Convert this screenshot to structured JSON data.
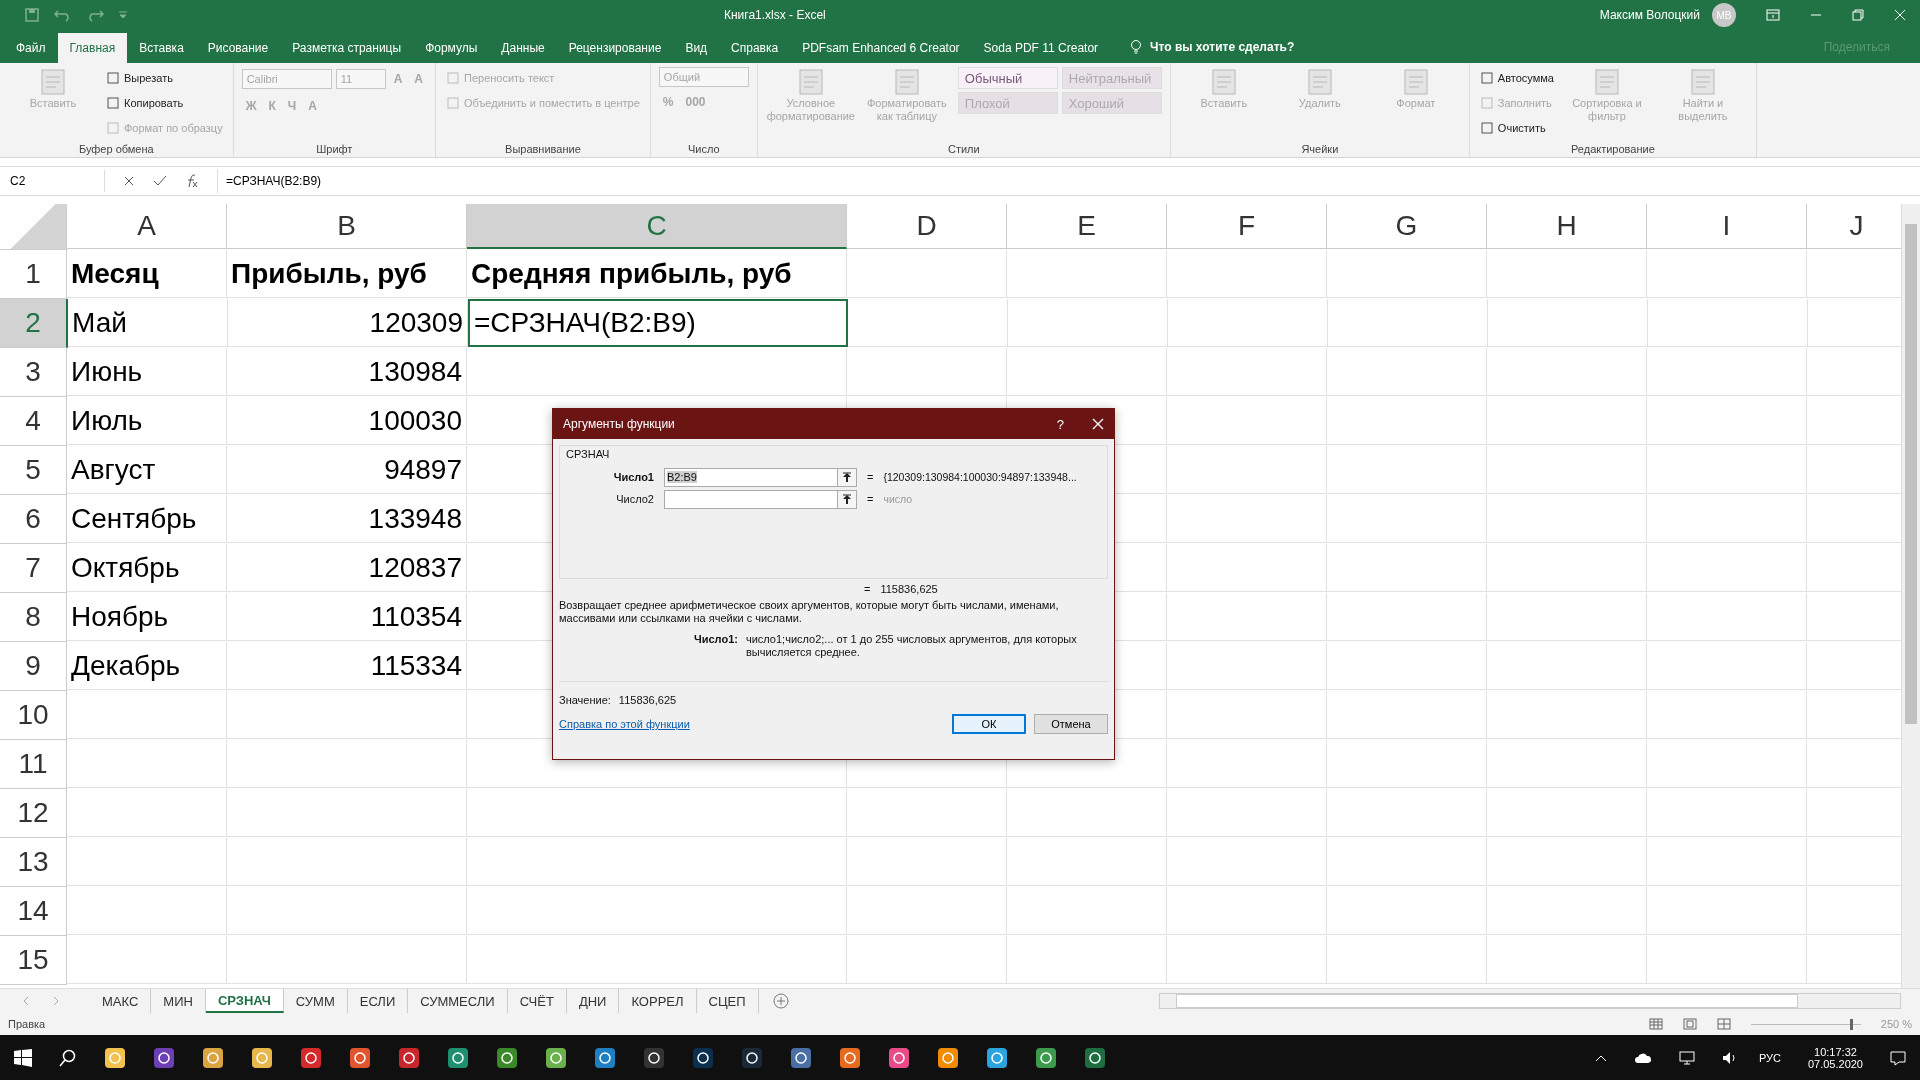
{
  "title_bar": {
    "title": "Книга1.xlsx  -  Excel",
    "user": "Максим Волоцкий",
    "avatar": "МВ"
  },
  "ribbon_tabs": [
    {
      "label": "Файл",
      "selected": false
    },
    {
      "label": "Главная",
      "selected": true
    },
    {
      "label": "Вставка",
      "selected": false
    },
    {
      "label": "Рисование",
      "selected": false
    },
    {
      "label": "Разметка страницы",
      "selected": false
    },
    {
      "label": "Формулы",
      "selected": false
    },
    {
      "label": "Данные",
      "selected": false
    },
    {
      "label": "Рецензирование",
      "selected": false
    },
    {
      "label": "Вид",
      "selected": false
    },
    {
      "label": "Справка",
      "selected": false
    },
    {
      "label": "PDFsam Enhanced 6 Creator",
      "selected": false
    },
    {
      "label": "Soda PDF 11 Creator",
      "selected": false
    }
  ],
  "tell_me": "Что вы хотите сделать?",
  "share": "Поделиться",
  "ribbon_groups": [
    {
      "label": "Буфер обмена",
      "columns": [
        [
          [
            {
              "kind": "large",
              "label": "Вставить",
              "disabled": true
            }
          ]
        ],
        [
          [
            {
              "kind": "small",
              "label": "Вырезать",
              "disabled": false
            }
          ],
          [
            {
              "kind": "small",
              "label": "Копировать",
              "disabled": false
            }
          ],
          [
            {
              "kind": "small",
              "label": "Формат по образцу",
              "disabled": true
            }
          ]
        ]
      ]
    },
    {
      "label": "Шрифт",
      "columns": [
        [
          [
            {
              "kind": "field",
              "label": "Calibri",
              "disabled": true
            },
            {
              "kind": "field",
              "label": "11",
              "disabled": true
            },
            {
              "kind": "glyph",
              "label": "A",
              "disabled": true
            },
            {
              "kind": "glyph",
              "label": "A",
              "disabled": true
            }
          ],
          [
            {
              "kind": "glyph",
              "label": "Ж",
              "disabled": true
            },
            {
              "kind": "glyph",
              "label": "К",
              "disabled": true
            },
            {
              "kind": "glyph",
              "label": "Ч",
              "disabled": true
            },
            {
              "kind": "glyph",
              "label": "A",
              "disabled": true
            }
          ]
        ]
      ]
    },
    {
      "label": "Выравнивание",
      "columns": [
        [
          [
            {
              "kind": "small",
              "label": "Переносить текст",
              "disabled": true
            }
          ],
          [
            {
              "kind": "small",
              "label": "Объединить и поместить в центре",
              "disabled": true
            }
          ]
        ]
      ]
    },
    {
      "label": "Число",
      "columns": [
        [
          [
            {
              "kind": "field",
              "label": "Общий",
              "disabled": true
            }
          ],
          [
            {
              "kind": "glyph",
              "label": "%",
              "disabled": true
            },
            {
              "kind": "glyph",
              "label": "000",
              "disabled": true
            }
          ]
        ]
      ]
    },
    {
      "label": "Стили",
      "columns": [
        [
          [
            {
              "kind": "large",
              "label": "Условное форматирование",
              "disabled": true
            }
          ]
        ],
        [
          [
            {
              "kind": "large",
              "label": "Форматировать как таблицу",
              "disabled": true
            }
          ]
        ],
        [
          [
            {
              "kind": "style",
              "label": "Обычный",
              "disabled": false,
              "color": "#f8f2f8"
            },
            {
              "kind": "style",
              "label": "Нейтральный",
              "disabled": true,
              "color": "#e8e2e8"
            }
          ],
          [
            {
              "kind": "style",
              "label": "Плохой",
              "disabled": true,
              "color": "#e6e0e6"
            },
            {
              "kind": "style",
              "label": "Хороший",
              "disabled": true,
              "color": "#e6e0e6"
            }
          ]
        ]
      ]
    },
    {
      "label": "Ячейки",
      "columns": [
        [
          [
            {
              "kind": "large",
              "label": "Вставить",
              "disabled": true
            }
          ]
        ],
        [
          [
            {
              "kind": "large",
              "label": "Удалить",
              "disabled": true
            }
          ]
        ],
        [
          [
            {
              "kind": "large",
              "label": "Формат",
              "disabled": true
            }
          ]
        ]
      ]
    },
    {
      "label": "Редактирование",
      "columns": [
        [
          [
            {
              "kind": "small",
              "label": "Автосумма",
              "disabled": false
            }
          ],
          [
            {
              "kind": "small",
              "label": "Заполнить",
              "disabled": true
            }
          ],
          [
            {
              "kind": "small",
              "label": "Очистить",
              "disabled": false
            }
          ]
        ],
        [
          [
            {
              "kind": "large",
              "label": "Сортировка и фильтр",
              "disabled": true
            }
          ]
        ],
        [
          [
            {
              "kind": "large",
              "label": "Найти и выделить",
              "disabled": true
            }
          ]
        ]
      ]
    }
  ],
  "formula_bar": {
    "name_box": "C2",
    "formula": "=СРЗНАЧ(B2:B9)"
  },
  "columns": [
    {
      "label": "A",
      "selected": false,
      "kind": "text"
    },
    {
      "label": "B",
      "selected": false,
      "kind": "number"
    },
    {
      "label": "C",
      "selected": true,
      "kind": "text"
    },
    {
      "label": "D",
      "selected": false,
      "kind": "text"
    },
    {
      "label": "E",
      "selected": false,
      "kind": "text"
    },
    {
      "label": "F",
      "selected": false,
      "kind": "text"
    },
    {
      "label": "G",
      "selected": false,
      "kind": "text"
    },
    {
      "label": "H",
      "selected": false,
      "kind": "text"
    },
    {
      "label": "I",
      "selected": false,
      "kind": "text"
    },
    {
      "label": "J",
      "selected": false,
      "kind": "text"
    }
  ],
  "rows": [
    {
      "number": "1",
      "selected": false,
      "kind": "header",
      "cells": [
        "Месяц",
        "Прибыль, руб",
        "Средняя прибыль, руб"
      ]
    },
    {
      "number": "2",
      "selected": true,
      "kind": "data",
      "cells": [
        "Май",
        "120309",
        "=СРЗНАЧ(B2:B9)"
      ]
    },
    {
      "number": "3",
      "selected": false,
      "kind": "data",
      "cells": [
        "Июнь",
        "130984"
      ]
    },
    {
      "number": "4",
      "selected": false,
      "kind": "data",
      "cells": [
        "Июль",
        "100030"
      ]
    },
    {
      "number": "5",
      "selected": false,
      "kind": "data",
      "cells": [
        "Август",
        "94897"
      ]
    },
    {
      "number": "6",
      "selected": false,
      "kind": "data",
      "cells": [
        "Сентябрь",
        "133948"
      ]
    },
    {
      "number": "7",
      "selected": false,
      "kind": "data",
      "cells": [
        "Октябрь",
        "120837"
      ]
    },
    {
      "number": "8",
      "selected": false,
      "kind": "data",
      "cells": [
        "Ноябрь",
        "110354"
      ]
    },
    {
      "number": "9",
      "selected": false,
      "kind": "data",
      "cells": [
        "Декабрь",
        "115334"
      ]
    },
    {
      "number": "10",
      "selected": false,
      "kind": "data"
    },
    {
      "number": "11",
      "selected": false,
      "kind": "data"
    },
    {
      "number": "12",
      "selected": false,
      "kind": "data"
    },
    {
      "number": "13",
      "selected": false,
      "kind": "data"
    },
    {
      "number": "14",
      "selected": false,
      "kind": "data"
    },
    {
      "number": "15",
      "selected": false,
      "kind": "data"
    }
  ],
  "dialog": {
    "title": "Аргументы функции",
    "help": "?",
    "function_name": "СРЗНАЧ",
    "args": [
      {
        "label": "Число1",
        "selected": true,
        "value": "B2:B9",
        "equals": "=",
        "result": "{120309:130984:100030:94897:133948..."
      },
      {
        "label": "Число2",
        "selected": false,
        "equals": "=",
        "result": "число"
      }
    ],
    "formula_equals": "=",
    "formula_result": "115836,625",
    "description": "Возвращает среднее арифметическое своих аргументов, которые могут быть числами, именами, массивами или ссылками на ячейки с числами.",
    "arg_help": {
      "label": "Число1:",
      "text": "число1;число2;... от 1 до 255 числовых аргументов, для которых вычисляется среднее."
    },
    "value_label": "Значение:",
    "value": "115836,625",
    "help_link": "Справка по этой функции",
    "buttons": [
      {
        "label": "ОК",
        "default": true
      },
      {
        "label": "Отмена",
        "default": false
      }
    ]
  },
  "sheet_tabs": [
    {
      "label": "МАКС",
      "selected": false
    },
    {
      "label": "МИН",
      "selected": false
    },
    {
      "label": "СРЗНАЧ",
      "selected": true
    },
    {
      "label": "СУММ",
      "selected": false
    },
    {
      "label": "ЕСЛИ",
      "selected": false
    },
    {
      "label": "СУММЕСЛИ",
      "selected": false
    },
    {
      "label": "СЧЁТ",
      "selected": false
    },
    {
      "label": "ДНИ",
      "selected": false
    },
    {
      "label": "КОРРЕЛ",
      "selected": false
    },
    {
      "label": "СЦЕП",
      "selected": false
    }
  ],
  "status_bar": {
    "mode": "Правка",
    "zoom_slider": {
      "level": 0.9
    },
    "zoom": "250 %"
  },
  "taskbar": {
    "language": "РУС",
    "time": "10:17:32",
    "date": "07.05.2020"
  }
}
